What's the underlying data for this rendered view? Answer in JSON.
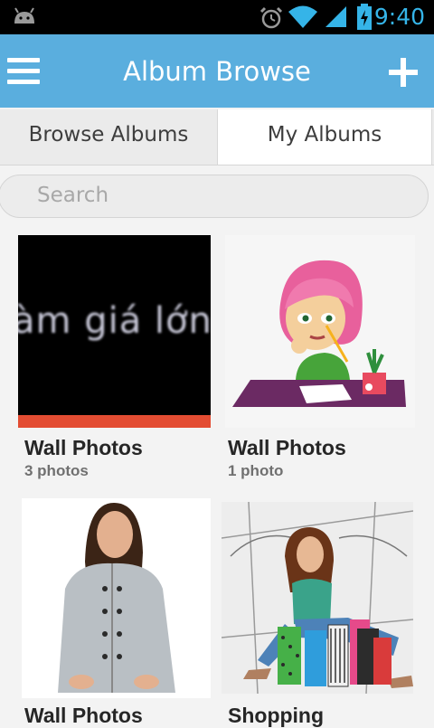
{
  "status_bar": {
    "time": "9:40",
    "icons": [
      "android-icon",
      "alarm-icon",
      "wifi-icon",
      "signal-icon",
      "battery-icon"
    ],
    "accent_color": "#35b4e8"
  },
  "action_bar": {
    "title": "Album Browse",
    "menu_icon": "menu-icon",
    "add_icon": "add-icon",
    "color": "#5aaede"
  },
  "tabs": [
    {
      "label": "Browse Albums",
      "selected": false
    },
    {
      "label": "My Albums",
      "selected": true
    }
  ],
  "search": {
    "placeholder": "Search"
  },
  "albums": [
    {
      "title": "Wall Photos",
      "count": "3 photos",
      "thumb_text": "àm giá lớn"
    },
    {
      "title": "Wall Photos",
      "count": "1 photo"
    },
    {
      "title": "Wall Photos",
      "count": ""
    },
    {
      "title": "Shopping",
      "count": ""
    }
  ]
}
